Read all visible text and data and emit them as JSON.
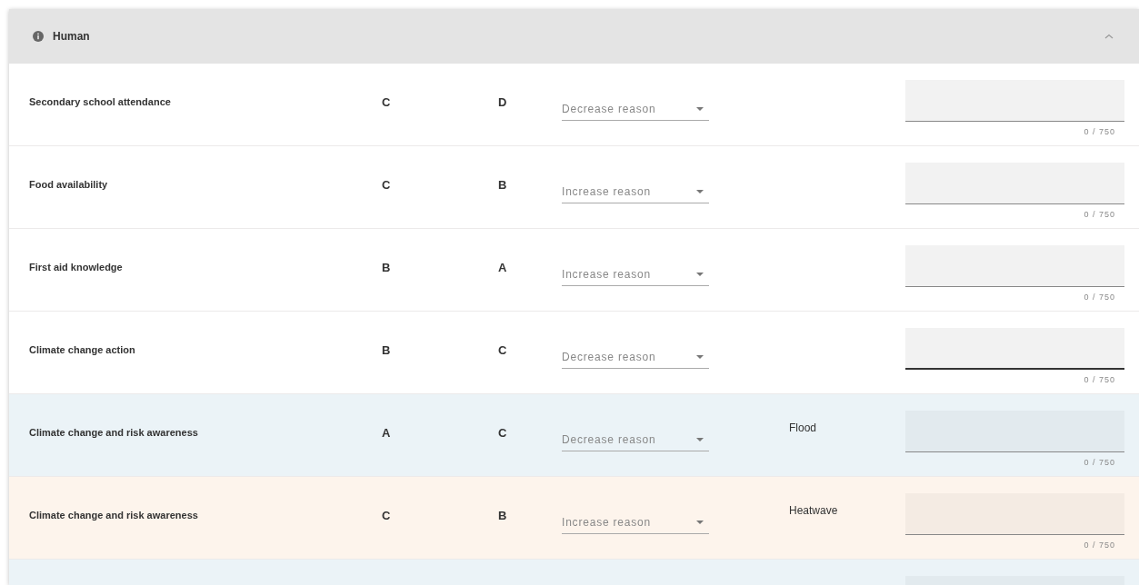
{
  "panel": {
    "title": "Human",
    "expanded": true
  },
  "rows": [
    {
      "indicator": "Secondary school attendance",
      "previous": "C",
      "current": "D",
      "reason": {
        "placeholder": "Decrease reason"
      },
      "comment": {
        "focused": false,
        "counter": "0 / 750"
      }
    },
    {
      "indicator": "Food availability",
      "previous": "C",
      "current": "B",
      "reason": {
        "placeholder": "Increase reason"
      },
      "comment": {
        "focused": false,
        "counter": "0 / 750"
      }
    },
    {
      "indicator": "First aid knowledge",
      "previous": "B",
      "current": "A",
      "reason": {
        "placeholder": "Increase reason"
      },
      "comment": {
        "focused": false,
        "counter": "0 / 750"
      }
    },
    {
      "indicator": "Climate change action",
      "previous": "B",
      "current": "C",
      "reason": {
        "placeholder": "Decrease reason"
      },
      "comment": {
        "focused": true,
        "counter": "0 / 750"
      }
    },
    {
      "indicator": "Climate change and risk awareness",
      "previous": "A",
      "current": "C",
      "reason": {
        "placeholder": "Decrease reason"
      },
      "hazard": "Flood",
      "color": "#ebf3f7",
      "comment": {
        "focused": false,
        "counter": "0 / 750"
      }
    },
    {
      "indicator": "Climate change and risk awareness",
      "previous": "C",
      "current": "B",
      "reason": {
        "placeholder": "Increase reason"
      },
      "hazard": "Heatwave",
      "color": "#fdf4ec",
      "comment": {
        "focused": false,
        "counter": "0 / 750"
      }
    },
    {
      "color": "#ebf3f7",
      "comment": {}
    }
  ]
}
